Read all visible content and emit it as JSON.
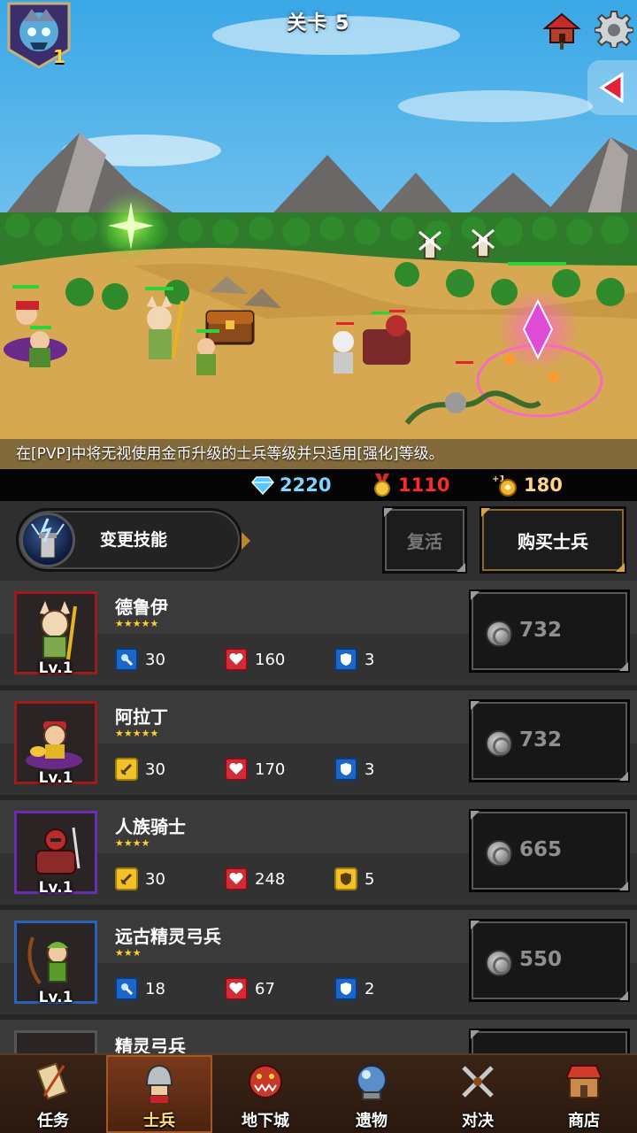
{
  "stage": {
    "title": "关卡 5",
    "boss_level": "1"
  },
  "notice": "在[PVP]中将无视使用金币升级的士兵等级并只适用[强化]等级。",
  "resources": {
    "gems": "2220",
    "gold": "1110",
    "souls": "180"
  },
  "controls": {
    "skill_label": "变更技能",
    "revive_label": "复活",
    "buy_label": "购买士兵"
  },
  "soldiers": [
    {
      "name": "德鲁伊",
      "stars": "★★★★★",
      "level": "Lv.1",
      "atk": "30",
      "hp": "160",
      "def": "3",
      "price": "732"
    },
    {
      "name": "阿拉丁",
      "stars": "★★★★★",
      "level": "Lv.1",
      "atk": "30",
      "hp": "170",
      "def": "3",
      "price": "732"
    },
    {
      "name": "人族骑士",
      "stars": "★★★★",
      "level": "Lv.1",
      "atk": "30",
      "hp": "248",
      "def": "5",
      "price": "665"
    },
    {
      "name": "远古精灵弓兵",
      "stars": "★★★",
      "level": "Lv.1",
      "atk": "18",
      "hp": "67",
      "def": "2",
      "price": "550"
    },
    {
      "name": "精灵弓兵"
    }
  ],
  "nav": [
    {
      "label": "任务",
      "icon": "scroll-icon"
    },
    {
      "label": "士兵",
      "icon": "helmet-icon"
    },
    {
      "label": "地下城",
      "icon": "monster-icon"
    },
    {
      "label": "遗物",
      "icon": "orb-icon"
    },
    {
      "label": "对决",
      "icon": "crossed-swords-icon"
    },
    {
      "label": "商店",
      "icon": "shop-icon"
    }
  ],
  "colors": {
    "gem": "#7fd3ff",
    "gold": "#ff2b2b",
    "soul": "#ffd48a",
    "star": "#ffcf2e",
    "active_tab": "#7a3a1a"
  }
}
